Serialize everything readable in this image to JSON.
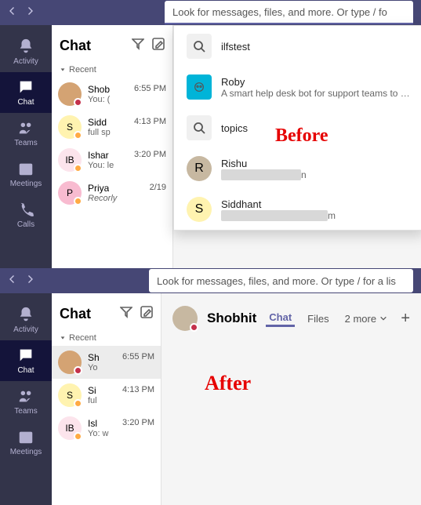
{
  "annotations": {
    "before": "Before",
    "after": "After"
  },
  "search": {
    "ph1": "Look for messages, files, and more. Or type / fo",
    "ph2": "Look for messages, files, and more. Or type / for a lis"
  },
  "sidebar": {
    "items": [
      {
        "label": "Activity"
      },
      {
        "label": "Chat"
      },
      {
        "label": "Teams"
      },
      {
        "label": "Meetings"
      },
      {
        "label": "Calls"
      }
    ]
  },
  "chat": {
    "title": "Chat",
    "section": "Recent"
  },
  "before_list": [
    {
      "name": "Shob",
      "time": "6:55 PM",
      "preview": "You: (",
      "av_bg": "#d4a373",
      "av_txt": "",
      "pres": "#c4314b"
    },
    {
      "name": "Sidd",
      "time": "4:13 PM",
      "preview": "full sp",
      "av_bg": "#fff3b0",
      "av_txt": "S",
      "pres": "#ffaa44"
    },
    {
      "name": "Ishar",
      "time": "3:20 PM",
      "preview": "You: le",
      "av_bg": "#fce4ec",
      "av_txt": "IB",
      "pres": "#ffaa44"
    },
    {
      "name": "Priya",
      "time": "2/19",
      "preview": "Recorly",
      "av_bg": "#f8bbd0",
      "av_txt": "P",
      "pres": "#ffaa44",
      "ital": true
    }
  ],
  "after_list": [
    {
      "name": "Sh",
      "time": "6:55 PM",
      "preview": "Yo",
      "av_bg": "#d4a373",
      "av_txt": "",
      "pres": "#c4314b"
    },
    {
      "name": "Si",
      "time": "4:13 PM",
      "preview": "ful",
      "av_bg": "#fff3b0",
      "av_txt": "S",
      "pres": "#ffaa44"
    },
    {
      "name": "Isl",
      "time": "3:20 PM",
      "preview": "Yo: w",
      "av_bg": "#fce4ec",
      "av_txt": "IB",
      "pres": "#ffaa44"
    }
  ],
  "dropdown": [
    {
      "type": "search",
      "title": "ilfstest"
    },
    {
      "type": "bot",
      "title": "Roby",
      "sub": "A smart help desk bot for support teams to inc"
    },
    {
      "type": "search",
      "title": "topics"
    },
    {
      "type": "person",
      "title": "Rishu",
      "sub": "████████████n",
      "av_bg": "#c7b8a1"
    },
    {
      "type": "person",
      "title": "Siddhant",
      "sub": "████████████████m",
      "av_bg": "#fff3b0"
    }
  ],
  "convo": {
    "name": "Shobhit",
    "tabs": [
      "Chat",
      "Files",
      "2 more"
    ]
  }
}
